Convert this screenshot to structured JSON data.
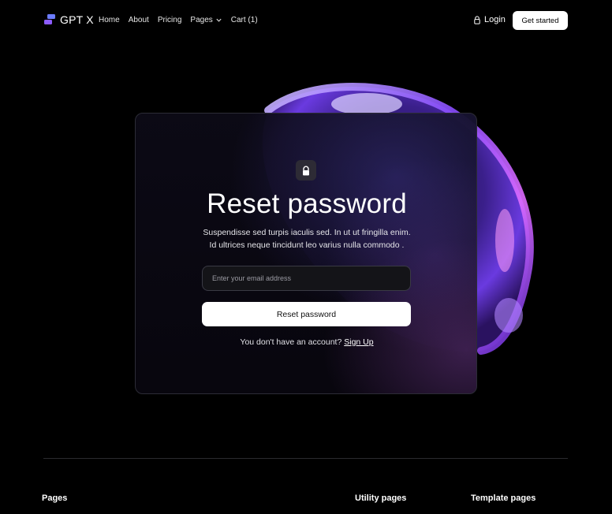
{
  "nav": {
    "logo_text": "GPT X",
    "links": [
      {
        "label": "Home"
      },
      {
        "label": "About"
      },
      {
        "label": "Pricing"
      },
      {
        "label": "Pages"
      },
      {
        "label": "Cart (1)"
      }
    ],
    "login_label": "Login",
    "cta_label": "Get started"
  },
  "card": {
    "title": "Reset password",
    "description_line1": "Suspendisse sed turpis iaculis sed. In ut ut fringilla enim.",
    "description_line2": "Id ultrices neque tincidunt leo varius nulla commodo .",
    "email_placeholder": "Enter your email address",
    "submit_label": "Reset password",
    "signup_prompt": "You don't have an account?",
    "signup_link": "Sign Up"
  },
  "footer": {
    "columns": [
      {
        "heading": "Pages"
      },
      {
        "heading": "Utility pages"
      },
      {
        "heading": "Template pages"
      }
    ]
  },
  "colors": {
    "background": "#000000",
    "accent_purple": "#7b4dff",
    "logo_blue": "#6c7cff",
    "button_bg": "#ffffff"
  },
  "icons": {
    "logo": "logo-mark-icon",
    "chevron": "chevron-down-icon",
    "login": "lock-icon",
    "card": "lock-icon"
  }
}
